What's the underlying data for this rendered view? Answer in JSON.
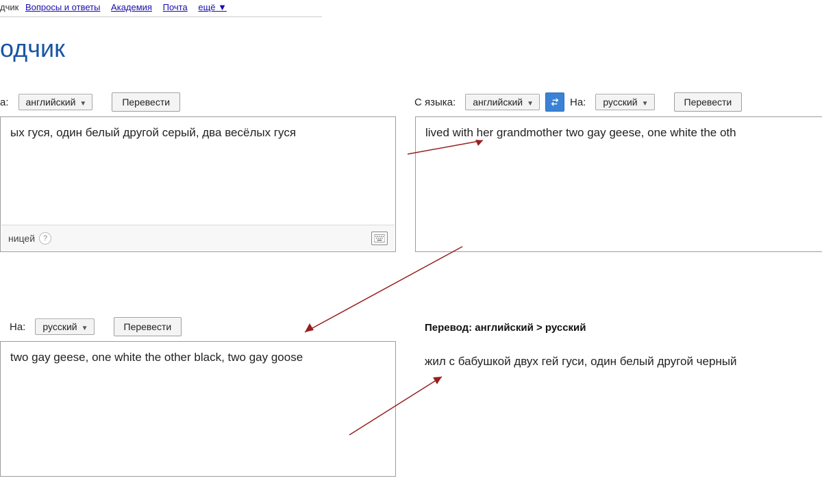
{
  "nav": {
    "item0": "дчик",
    "item1": "Вопросы и ответы",
    "item2": "Академия",
    "item3": "Почта",
    "more": "ещё ▼"
  },
  "title": "одчик",
  "labels": {
    "to": "а:",
    "from": "С языка:",
    "to2": "На:",
    "to3": "На:"
  },
  "langs": {
    "english": "английский",
    "russian": "русский"
  },
  "buttons": {
    "translate": "Перевести"
  },
  "panel1": {
    "text": "ых гуся, один белый другой серый, два весёлых гуся",
    "hint": "ницей"
  },
  "panel2": {
    "text": "lived with her grandmother two gay geese, one white the oth"
  },
  "panel3": {
    "text": "two gay geese, one white the other black, two gay goose"
  },
  "result": {
    "heading": "Перевод: английский > русский",
    "text": "жил с бабушкой двух гей гуси, один белый другой черный"
  }
}
